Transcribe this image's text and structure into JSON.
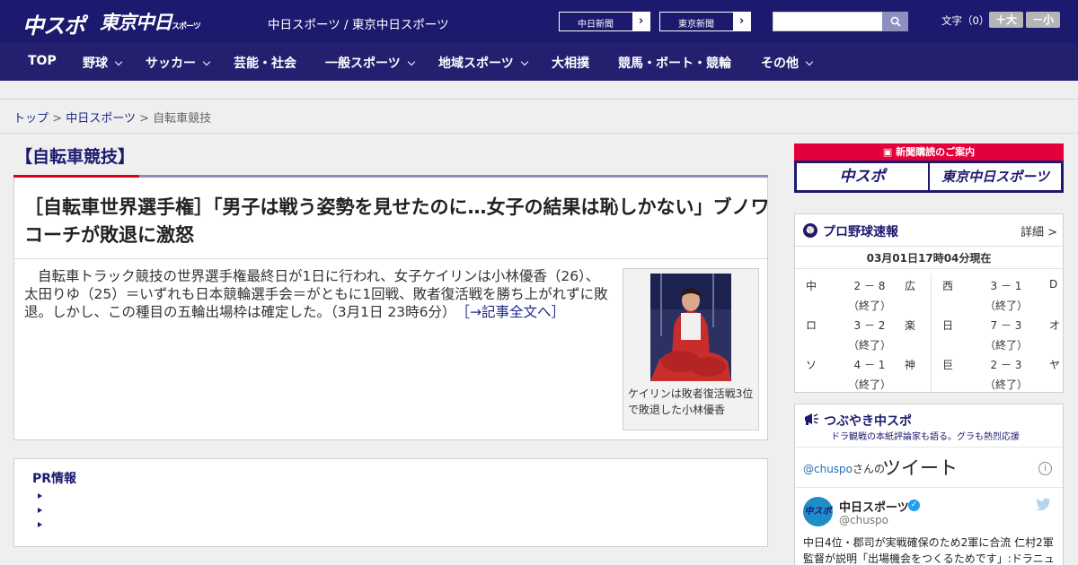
{
  "header": {
    "logo_chunichi": "中スポ",
    "logo_tokyo": "東京中日",
    "logo_tokyo_suffix": "スポーツ",
    "site_title": "中日スポーツ / 東京中日スポーツ",
    "btn_chunichi": "中日新聞",
    "btn_tokyo": "東京新聞",
    "arrow": "›",
    "search_placeholder": "",
    "fontsize_label": "文字（0）",
    "fontsize_large": "＋大",
    "fontsize_small": "－小"
  },
  "nav": {
    "items": [
      "TOP",
      "野球",
      "サッカー",
      "芸能・社会",
      "一般スポーツ",
      "地域スポーツ",
      "大相撲",
      "競馬・ボート・競輪",
      "その他"
    ]
  },
  "breadcrumb": {
    "top": "トップ",
    "sep": ">",
    "section": "中日スポーツ",
    "current": "自転車競技"
  },
  "category_title": "【自転車競技】",
  "article": {
    "headline": "［自転車世界選手権］「男子は戦う姿勢を見せたのに…女子の結果は恥しかない」ブノワコーチが敗退に激怒",
    "lead": "自転車トラック競技の世界選手権最終日が1日に行われ、女子ケイリンは小林優香（26）、太田りゆ（25）＝いずれも日本競輪選手会＝がともに1回戦、敗者復活戦を勝ち上がれずに敗退。しかし、この種目の五輪出場枠は確定した。（3月1日 23時6分）",
    "more_link": "［→記事全文へ］",
    "photo_caption": "ケイリンは敗者復活戦3位で敗退した小林優香"
  },
  "pr": {
    "title": "PR情報"
  },
  "subscribe": {
    "head": "新聞購読のご案内",
    "logo_chunichi": "中スポ",
    "logo_tokyo": "東京中日スポーツ"
  },
  "baseball": {
    "icon": "⚾",
    "title": "プロ野球速報",
    "detail": "詳細 >",
    "time": "03月01日17時04分現在",
    "games": [
      {
        "home": "中",
        "score": "2 － 8",
        "away": "広",
        "status": "（終了）"
      },
      {
        "home": "西",
        "score": "3 － 1",
        "away": "D",
        "status": "（終了）"
      },
      {
        "home": "ロ",
        "score": "3 － 2",
        "away": "楽",
        "status": "（終了）"
      },
      {
        "home": "日",
        "score": "7 － 3",
        "away": "オ",
        "status": "（終了）"
      },
      {
        "home": "ソ",
        "score": "4 － 1",
        "away": "神",
        "status": "（終了）"
      },
      {
        "home": "巨",
        "score": "2 － 3",
        "away": "ヤ",
        "status": "（終了）"
      }
    ]
  },
  "tweets": {
    "title": "つぶやき中スポ",
    "subtitle": "ドラ観戦の本紙評論家も語る。グラも熱烈応援",
    "handle": "@chuspo",
    "handle_suffix": "さんの",
    "label": "ツイート",
    "info": "i",
    "avatar": "中スポ",
    "account_name": "中日スポーツ",
    "verified": "✓",
    "account_handle": "@chuspo",
    "text": "中日4位・郡司が実戦確保のため2軍に合流 仁村2軍監督が説明「出場機会をつくるためです」:ドラニュ"
  },
  "colors": {
    "header_bg": "#1c1a6e",
    "nav_bg": "#24206f",
    "accent_red": "#d9001b",
    "link": "#1e2a8a"
  }
}
